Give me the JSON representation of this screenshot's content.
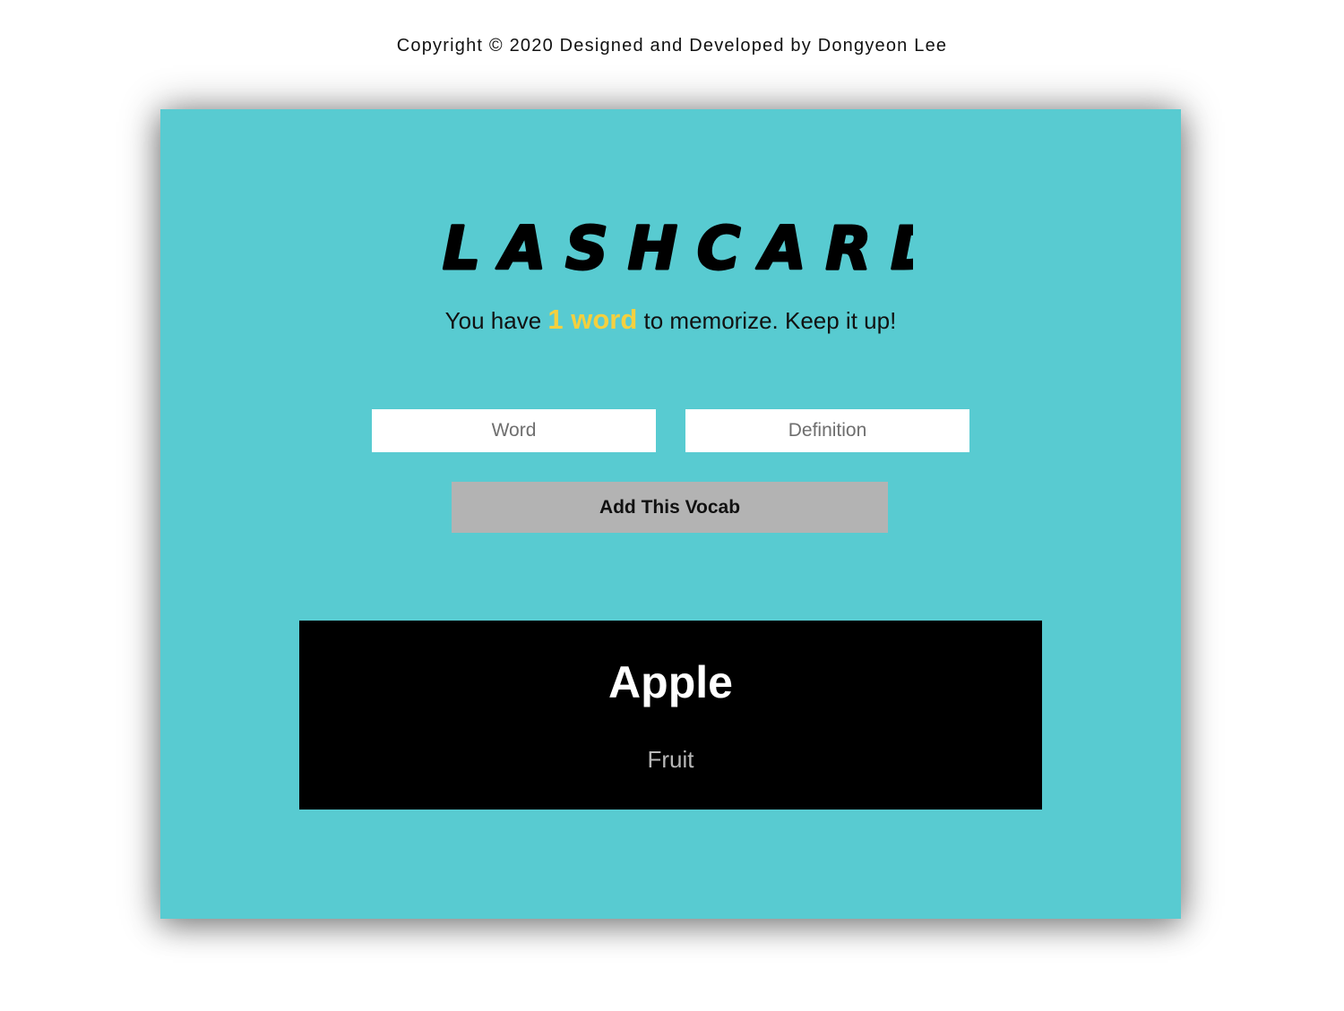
{
  "footer": {
    "credit": "Copyright © 2020 Designed and Developed by Dongyeon Lee"
  },
  "app": {
    "title": "FLASHCARD",
    "tagline_prefix": "You have ",
    "word_count": "1 word",
    "tagline_suffix": " to memorize. Keep it up!",
    "accent_color": "#f4d03f",
    "background_color": "#58cbd1"
  },
  "form": {
    "word_placeholder": "Word",
    "word_value": "",
    "definition_placeholder": "Definition",
    "definition_value": "",
    "submit_label": "Add This Vocab"
  },
  "cards": [
    {
      "word": "Apple",
      "definition": "Fruit"
    }
  ]
}
